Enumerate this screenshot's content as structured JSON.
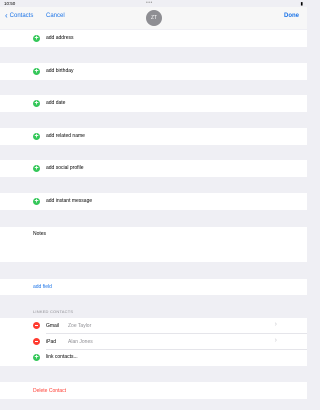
{
  "status_bar": {
    "time": "10:50",
    "dots": "•••",
    "battery": "▮"
  },
  "nav": {
    "back_label": "Contacts",
    "cancel_label": "Cancel",
    "avatar_initials": "ZT",
    "done_label": "Done"
  },
  "add_rows": [
    "add address",
    "add birthday",
    "add date",
    "add related name",
    "add social profile",
    "add instant message"
  ],
  "notes_label": "Notes",
  "add_field_label": "add field",
  "linked_contacts": {
    "header": "LINKED CONTACTS",
    "items": [
      {
        "service": "Gmail",
        "name": "Zoe Taylor"
      },
      {
        "service": "iPad",
        "name": "Alan Jones"
      }
    ],
    "link_label": "link contacts..."
  },
  "delete_label": "Delete Contact",
  "colors": {
    "accent": "#1a73e8",
    "add": "#34c759",
    "remove": "#ff3b30"
  }
}
